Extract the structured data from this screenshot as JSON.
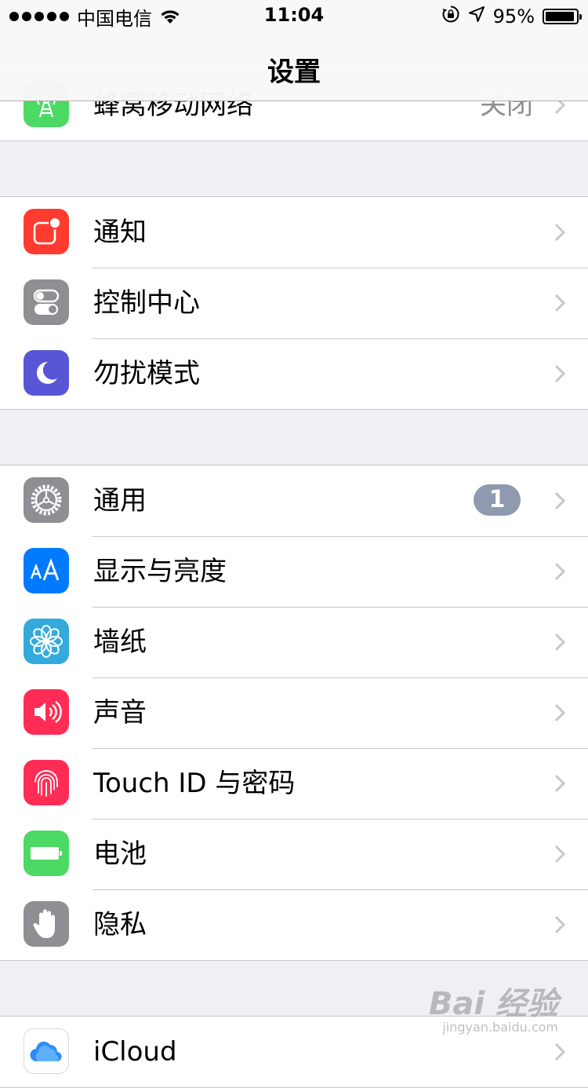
{
  "status_bar": {
    "carrier": "中国电信",
    "time": "11:04",
    "battery_percent": "95%",
    "battery_level": 0.95,
    "signal_dots": 5
  },
  "nav": {
    "title": "设置"
  },
  "groups": [
    {
      "rows": [
        {
          "name": "cellular",
          "label": "蜂窝移动网络",
          "detail": "关闭",
          "icon": "antenna-icon",
          "icon_color": "#4cd964"
        }
      ]
    },
    {
      "rows": [
        {
          "name": "notifications",
          "label": "通知",
          "icon": "notification-icon",
          "icon_color": "#ff3b30"
        },
        {
          "name": "control-center",
          "label": "控制中心",
          "icon": "toggles-icon",
          "icon_color": "#8e8e93"
        },
        {
          "name": "do-not-disturb",
          "label": "勿扰模式",
          "icon": "moon-icon",
          "icon_color": "#5856d6"
        }
      ]
    },
    {
      "rows": [
        {
          "name": "general",
          "label": "通用",
          "badge": "1",
          "icon": "gear-icon",
          "icon_color": "#8e8e93"
        },
        {
          "name": "display-brightness",
          "label": "显示与亮度",
          "icon": "text-size-icon",
          "icon_color": "#007aff"
        },
        {
          "name": "wallpaper",
          "label": "墙纸",
          "icon": "flower-icon",
          "icon_color": "#34aadc"
        },
        {
          "name": "sounds",
          "label": "声音",
          "icon": "speaker-icon",
          "icon_color": "#ff2d55"
        },
        {
          "name": "touch-id-passcode",
          "label": "Touch ID 与密码",
          "icon": "fingerprint-icon",
          "icon_color": "#ff2d55"
        },
        {
          "name": "battery",
          "label": "电池",
          "icon": "battery-icon",
          "icon_color": "#4cd964"
        },
        {
          "name": "privacy",
          "label": "隐私",
          "icon": "hand-icon",
          "icon_color": "#8e8e93"
        }
      ]
    },
    {
      "rows": [
        {
          "name": "icloud",
          "label": "iCloud",
          "icon": "cloud-icon",
          "icon_color": "#ffffff"
        }
      ]
    }
  ],
  "watermark": {
    "main": "Bai 经验",
    "sub": "jingyan.baidu.com"
  }
}
